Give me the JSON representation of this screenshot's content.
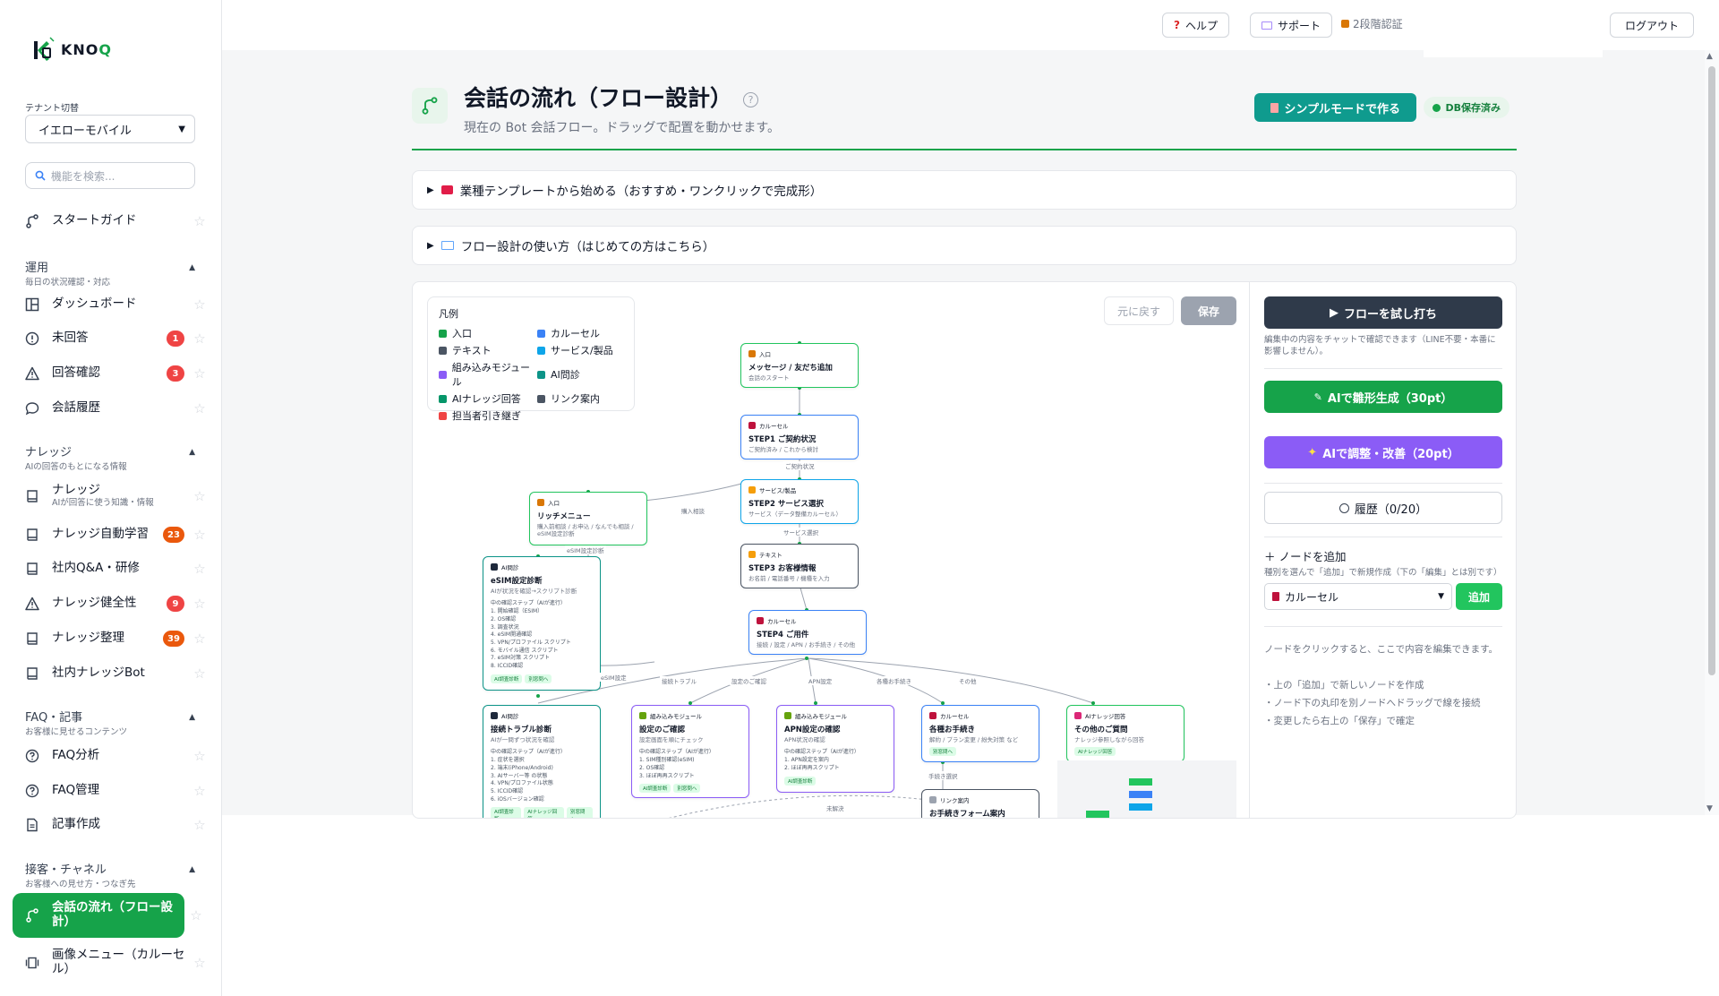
{
  "brand": {
    "name_main": "KNO",
    "name_accent": "Q"
  },
  "sidebar": {
    "tenant_label": "テナント切替",
    "tenant_value": "イエローモバイル",
    "search_placeholder": "機能を検索...",
    "start_guide": "スタートガイド",
    "sections": [
      {
        "title": "運用",
        "sub": "毎日の状況確認・対応"
      },
      {
        "title": "ナレッジ",
        "sub": "AIの回答のもとになる情報"
      },
      {
        "title": "FAQ・記事",
        "sub": "お客様に見せるコンテンツ"
      },
      {
        "title": "接客・チャネル",
        "sub": "お客様への見せ方・つなぎ先"
      }
    ],
    "items": [
      {
        "label": "ダッシュボード"
      },
      {
        "label": "未回答",
        "badge": "1"
      },
      {
        "label": "回答確認",
        "badge": "3"
      },
      {
        "label": "会話履歴"
      },
      {
        "label": "ナレッジ",
        "sub": "AIが回答に使う知識・情報"
      },
      {
        "label": "ナレッジ自動学習",
        "badge": "23"
      },
      {
        "label": "社内Q&A・研修"
      },
      {
        "label": "ナレッジ健全性",
        "badge": "9"
      },
      {
        "label": "ナレッジ整理",
        "badge": "39"
      },
      {
        "label": "社内ナレッジBot"
      },
      {
        "label": "FAQ分析"
      },
      {
        "label": "FAQ管理"
      },
      {
        "label": "記事作成"
      },
      {
        "label": "会話の流れ（フロー設計）"
      },
      {
        "label": "画像メニュー（カルーセル）"
      }
    ]
  },
  "topbar": {
    "help": "ヘルプ",
    "support": "サポート",
    "twofa": "2段階認証",
    "logout": "ログアウト"
  },
  "page": {
    "title": "会話の流れ（フロー設計）",
    "help_mark": "?",
    "subtitle": "現在の Bot 会話フロー。ドラッグで配置を動かせます。",
    "simple_mode_btn": "シンプルモードで作る",
    "db_status": "DB保存済み",
    "accordion_templates": "業種テンプレートから始める（おすすめ・ワンクリックで完成形）",
    "accordion_howto": "フロー設計の使い方（はじめての方はこちら）"
  },
  "legend": {
    "title": "凡例",
    "items": [
      {
        "label": "入口",
        "color": "#16a34a"
      },
      {
        "label": "カルーセル",
        "color": "#3b82f6"
      },
      {
        "label": "テキスト",
        "color": "#4b5563"
      },
      {
        "label": "サービス/製品",
        "color": "#0ea5e9"
      },
      {
        "label": "組み込みモジュール",
        "color": "#8b5cf6"
      },
      {
        "label": "AI問診",
        "color": "#0d9488"
      },
      {
        "label": "AIナレッジ回答",
        "color": "#059669"
      },
      {
        "label": "リンク案内",
        "color": "#4b5563"
      },
      {
        "label": "担当者引き継ぎ",
        "color": "#ef4444"
      }
    ]
  },
  "canvas": {
    "undo": "元に戻す",
    "save": "保存",
    "nodes": {
      "n1": {
        "tag": "入口",
        "title": "メッセージ / 友だち追加",
        "desc": "会話のスタート"
      },
      "n2": {
        "tag": "カルーセル",
        "title": "STEP1 ご契約状況",
        "desc": "ご契約済み / これから検討"
      },
      "n3": {
        "tag": "サービス/製品",
        "title": "STEP2 サービス選択",
        "desc": "サービス（データ整備カルーセル）"
      },
      "n4": {
        "tag": "テキスト",
        "title": "STEP3 お客様情報",
        "desc": "お名前 / 電話番号 / 機種を入力"
      },
      "n5": {
        "tag": "カルーセル",
        "title": "STEP4 ご用件",
        "desc": "接続 / 設定 / APN / お手続き / その他"
      },
      "n6": {
        "tag": "入口",
        "title": "リッチメニュー",
        "desc": "購入前相談 / お申込 / なんでも相談 / eSIM設定診断"
      },
      "n7": {
        "tag": "AI問診",
        "title": "eSIM設定診断",
        "desc": "AIが状況を確認→スクリプト診断",
        "steps": "中の確認ステップ（AIが進行）\n1. 開始確認（ESIM）\n2. OS確認\n3. 調査状況\n4. eSIM開通確認\n5. VPN/プロファイル スクリプト\n6. モバイル通信 スクリプト\n7. eSIM対策 スクリプト\n8. ICCID確認",
        "chips": [
          "AI調査診断",
          "別窓問へ"
        ]
      },
      "n8": {
        "tag": "AI問診",
        "title": "接続トラブル診断",
        "desc": "AIが一問ずつ状況を確認",
        "steps": "中の確認ステップ（AIが進行）\n1. 症状を選択\n2. 端末(iPhone/Android)\n3. AIサーバー等 の状態\n4. VPN/プロファイル状態\n5. ICCID確認\n6. iOSバージョン確認",
        "chips": [
          "AI調査診断",
          "AIナレッジ回答",
          "別窓問へ"
        ]
      },
      "n9": {
        "tag": "組み込みモジュール",
        "title": "設定のご確認",
        "desc": "設定画面を順にチェック",
        "steps": "中の確認ステップ（AIが進行）\n1. SIM種別確認(eSIM)\n2. OS確認\n3. ほぼ再再スクリプト",
        "chips": [
          "AI調査診断",
          "別窓問へ"
        ]
      },
      "n10": {
        "tag": "組み込みモジュール",
        "title": "APN設定の確認",
        "desc": "APN状況の確認",
        "steps": "中の確認ステップ（AIが進行）\n1. APN設定を案内\n2. ほぼ再再スクリプト",
        "chips": [
          "AI調査診断"
        ]
      },
      "n11": {
        "tag": "カルーセル",
        "title": "各種お手続き",
        "desc": "解約 / プラン変更 / 紛失対策 など",
        "chips": [
          "別窓問へ"
        ]
      },
      "n12": {
        "tag": "AIナレッジ回答",
        "title": "その他のご質問",
        "desc": "ナレッジ参照しながら回答",
        "chips": [
          "AIナレッジ回答"
        ]
      },
      "n13": {
        "tag": "リンク案内",
        "title": "お手続きフォーム案内",
        "desc": ""
      }
    },
    "edge_labels": [
      "ご契約状況",
      "サービス選択",
      "購入相談",
      "eSIM設定診断",
      "eSIM設定",
      "接続トラブル",
      "設定のご確認",
      "APN設定",
      "各種お手続き",
      "その他",
      "手続き選択",
      "未解決"
    ]
  },
  "right": {
    "test_btn": "フローを試し打ち",
    "test_note": "編集中の内容をチャットで確認できます（LINE不要・本番に影響しません）。",
    "ai_gen": "AIで雛形生成（30pt）",
    "ai_tune": "AIで調整・改善（20pt）",
    "history": "履歴（0/20）",
    "add_title": "＋ ノードを追加",
    "add_sub": "種別を選んで「追加」で新規作成（下の「編集」とは別です）",
    "add_select": "カルーセル",
    "add_btn": "追加",
    "hint1": "ノードをクリックすると、ここで内容を編集できます。",
    "hint2": "・上の「追加」で新しいノードを作成",
    "hint3": "・ノード下の丸印を別ノードへドラッグで線を接続",
    "hint4": "・変更したら右上の「保存」で確定"
  },
  "colors": {
    "accent": "#16a34a",
    "teal": "#0f9b8e",
    "purple": "#8b5cf6",
    "dark": "#2f3a4a",
    "badge_red": "#ef4444"
  }
}
